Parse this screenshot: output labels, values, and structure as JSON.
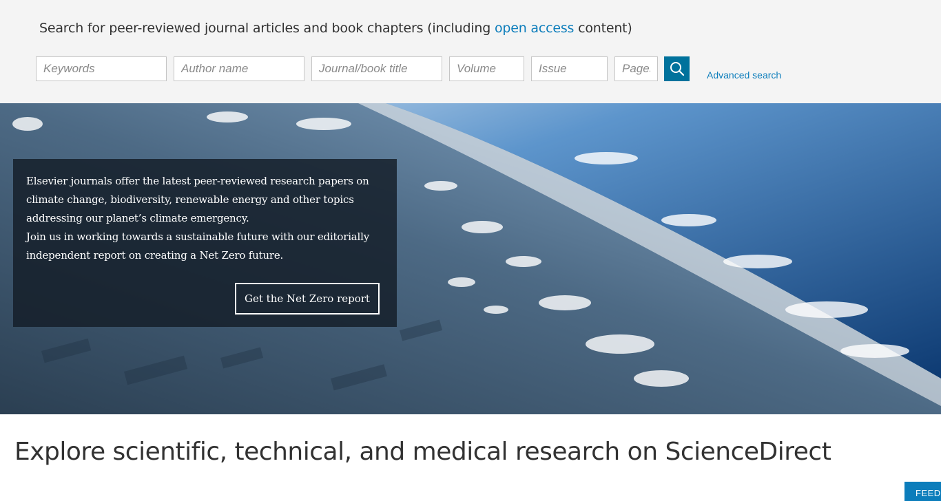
{
  "search": {
    "heading_prefix": "Search for peer-reviewed journal articles and book chapters (including ",
    "heading_link": "open access",
    "heading_suffix": " content)",
    "keywords_placeholder": "Keywords",
    "author_placeholder": "Author name",
    "journal_placeholder": "Journal/book title",
    "volume_placeholder": "Volume",
    "issue_placeholder": "Issue",
    "pages_placeholder": "Pages",
    "search_icon": "search-icon",
    "advanced_label": "Advanced search"
  },
  "hero": {
    "paragraph_1": "Elsevier journals offer the latest peer-reviewed research papers on climate change, biodiversity, renewable energy and other topics addressing our planet’s climate emergency.",
    "paragraph_2": "Join us in working towards a sustainable future with our editorially independent report on creating a Net Zero future.",
    "cta_label": "Get the Net Zero report"
  },
  "main": {
    "title": "Explore scientific, technical, and medical research on ScienceDirect"
  },
  "feedback": {
    "label": "FEEDBACK"
  },
  "colors": {
    "accent": "#0c7dbb",
    "search_button": "#00729c",
    "band_bg": "#f4f4f4"
  }
}
